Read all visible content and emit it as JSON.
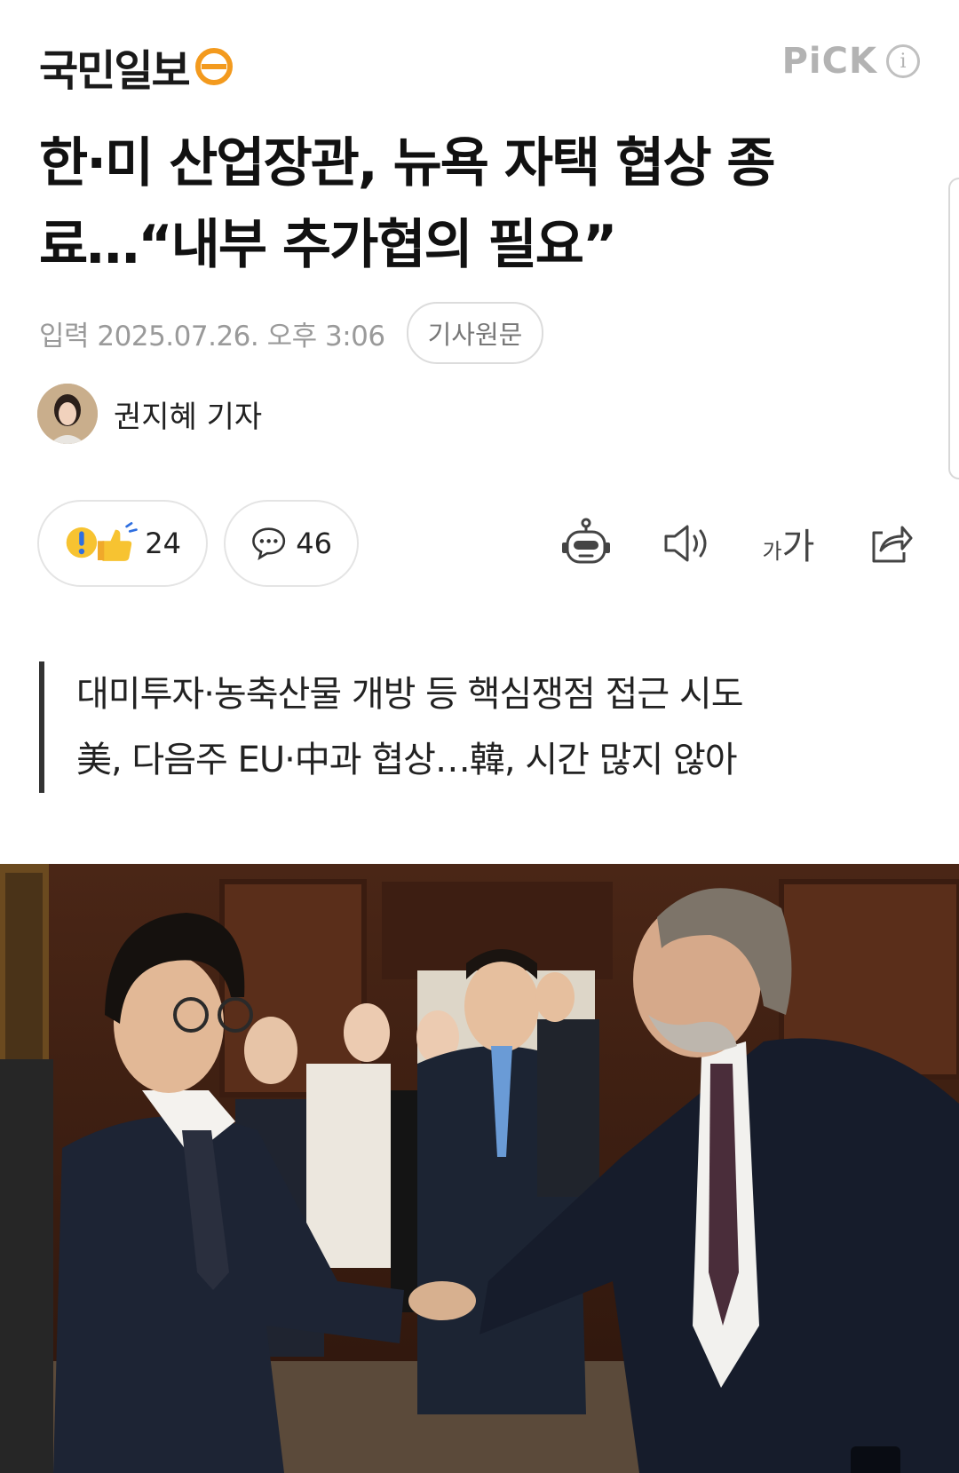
{
  "header": {
    "logo_text": "국민일보",
    "pick_label": "PiCK",
    "pick_info_label": "i"
  },
  "article": {
    "title": "한·미 산업장관, 뉴욕 자택 협상 종료…“내부 추가협의 필요”",
    "date": "입력 2025.07.26. 오후 3:06",
    "original_button": "기사원문",
    "reporter": "권지혜 기자",
    "reactions_count": "24",
    "comments_count": "46",
    "font_size_label": "가",
    "summary": [
      "대미투자·농축산물 개방 등 핵심쟁점 접근 시도",
      "美, 다음주 EU·中과 협상…韓, 시간 많지 않아"
    ]
  },
  "icons": [
    "logo-mark-icon",
    "info-icon",
    "reaction-icon",
    "comment-icon",
    "ai-robot-icon",
    "speaker-icon",
    "font-size-icon",
    "share-icon",
    "expand-icon"
  ],
  "colors": {
    "logo_orange": "#f39a1e",
    "pick_gray": "#b3b3b3",
    "meta_gray": "#9a9a9a"
  }
}
